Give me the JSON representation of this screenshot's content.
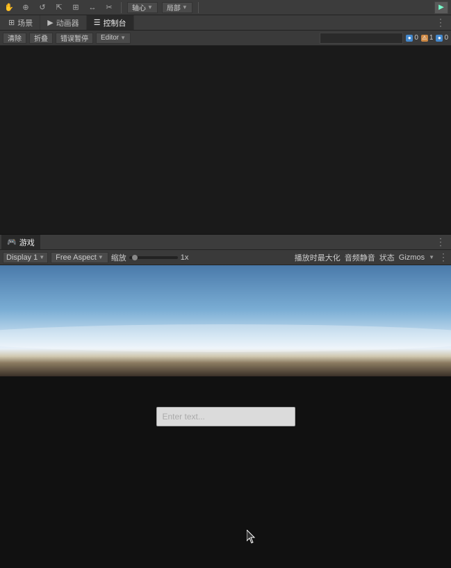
{
  "toolbar": {
    "icons": [
      "✋",
      "⊕",
      "↺",
      "📊",
      "⊞",
      "↔",
      "✂"
    ],
    "center_labels": [
      "轴心",
      "局部"
    ],
    "play_button": "▶",
    "kebab": "⋮"
  },
  "tabs": {
    "items": [
      {
        "label": "场景",
        "icon": "⊞",
        "active": false
      },
      {
        "label": "动画器",
        "icon": "▶",
        "active": false
      },
      {
        "label": "控制台",
        "icon": "☰",
        "active": true
      }
    ]
  },
  "second_toolbar": {
    "clear_btn": "清除",
    "collapse_btn": "折叠",
    "error_pause_btn": "错误暂停",
    "editor_btn": "Editor",
    "search_placeholder": "",
    "status_items": [
      {
        "icon": "●",
        "count": "0",
        "type": "info"
      },
      {
        "icon": "⚠",
        "count": "1",
        "type": "warn"
      },
      {
        "icon": "●",
        "count": "0",
        "type": "error"
      }
    ]
  },
  "scene_viewport": {
    "bg_color": "#1a1a1a"
  },
  "game_tab": {
    "icon": "🎮",
    "label": "游戏",
    "active": true,
    "kebab": "⋮"
  },
  "game_controls": {
    "display_label": "Display 1",
    "aspect_label": "Free Aspect",
    "scale_label": "缩放",
    "scale_value": "1x",
    "right_items": [
      "播放时最大化",
      "音频静音",
      "状态",
      "Gizmos"
    ],
    "arrow": "▼",
    "kebab": "⋮"
  },
  "game_viewport": {
    "text_input_placeholder": "Enter text...",
    "cursor_char": "🖱"
  }
}
